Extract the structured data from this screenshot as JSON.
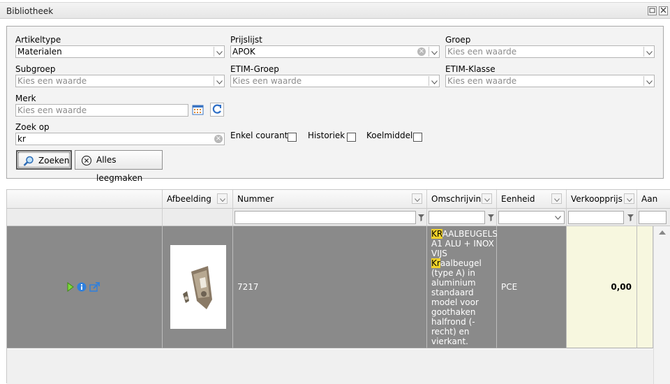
{
  "window": {
    "title": "Bibliotheek"
  },
  "filters": {
    "artikeltype": {
      "label": "Artikeltype",
      "value": "Materialen"
    },
    "prijslijst": {
      "label": "Prijslijst",
      "value": "APOK"
    },
    "groep": {
      "label": "Groep",
      "placeholder": "Kies een waarde"
    },
    "subgroep": {
      "label": "Subgroep",
      "placeholder": "Kies een waarde"
    },
    "etim_groep": {
      "label": "ETIM-Groep",
      "placeholder": "Kies een waarde"
    },
    "etim_klasse": {
      "label": "ETIM-Klasse",
      "placeholder": "Kies een waarde"
    },
    "merk": {
      "label": "Merk",
      "placeholder": "Kies een waarde"
    },
    "zoek_op": {
      "label": "Zoek op",
      "value": "kr"
    },
    "enkel_courant": {
      "label": "Enkel courant",
      "checked": false
    },
    "historiek": {
      "label": "Historiek",
      "checked": false
    },
    "koelmiddel": {
      "label": "Koelmiddel",
      "checked": false
    }
  },
  "buttons": {
    "search": "Zoeken",
    "clear_all": "Alles leegmaken"
  },
  "grid": {
    "columns": [
      "Afbeelding",
      "Nummer",
      "Omschrijving",
      "Eenheid",
      "Verkoopprijs 3",
      "Aan"
    ],
    "rows": [
      {
        "nummer": "7217",
        "omschrijving_hl1": "KR",
        "omschrijving_rest1": "AALBEUGELS A1 ALU + INOX VIJS",
        "omschrijving_hl2": "Kr",
        "omschrijving_rest2": "aalbeugel (type A) in aluminium standaard model voor goothaken halfrond (-recht) en vierkant.",
        "eenheid": "PCE",
        "verkoopprijs": "0,00"
      }
    ]
  },
  "colors": {
    "row_selected": "#8a8a8a",
    "highlight": "#f2d22a",
    "price_cell": "#f7f7df"
  }
}
